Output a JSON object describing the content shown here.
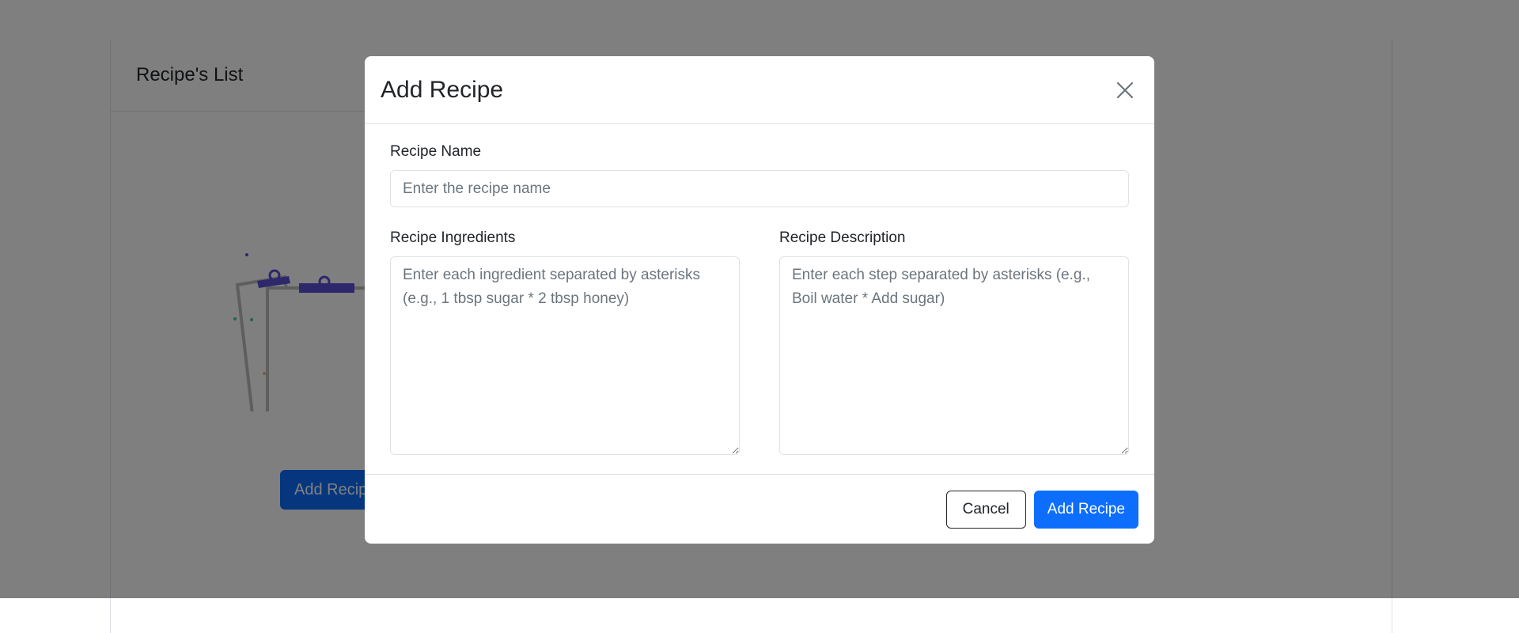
{
  "background": {
    "list_panel": {
      "title": "Recipe's List",
      "add_button_label": "Add Recipe"
    }
  },
  "modal": {
    "title": "Add Recipe",
    "close_icon": "close-icon",
    "fields": {
      "name": {
        "label": "Recipe Name",
        "placeholder": "Enter the recipe name",
        "value": ""
      },
      "ingredients": {
        "label": "Recipe Ingredients",
        "placeholder": "Enter each ingredient separated by asterisks (e.g., 1 tbsp sugar * 2 tbsp honey)",
        "value": ""
      },
      "description": {
        "label": "Recipe Description",
        "placeholder": "Enter each step separated by asterisks (e.g., Boil water * Add sugar)",
        "value": ""
      }
    },
    "footer": {
      "cancel_label": "Cancel",
      "submit_label": "Add Recipe"
    }
  },
  "colors": {
    "primary": "#0d6efd",
    "backdrop": "rgba(0,0,0,0.5)",
    "illustration_accent": "#5b4fd6"
  }
}
